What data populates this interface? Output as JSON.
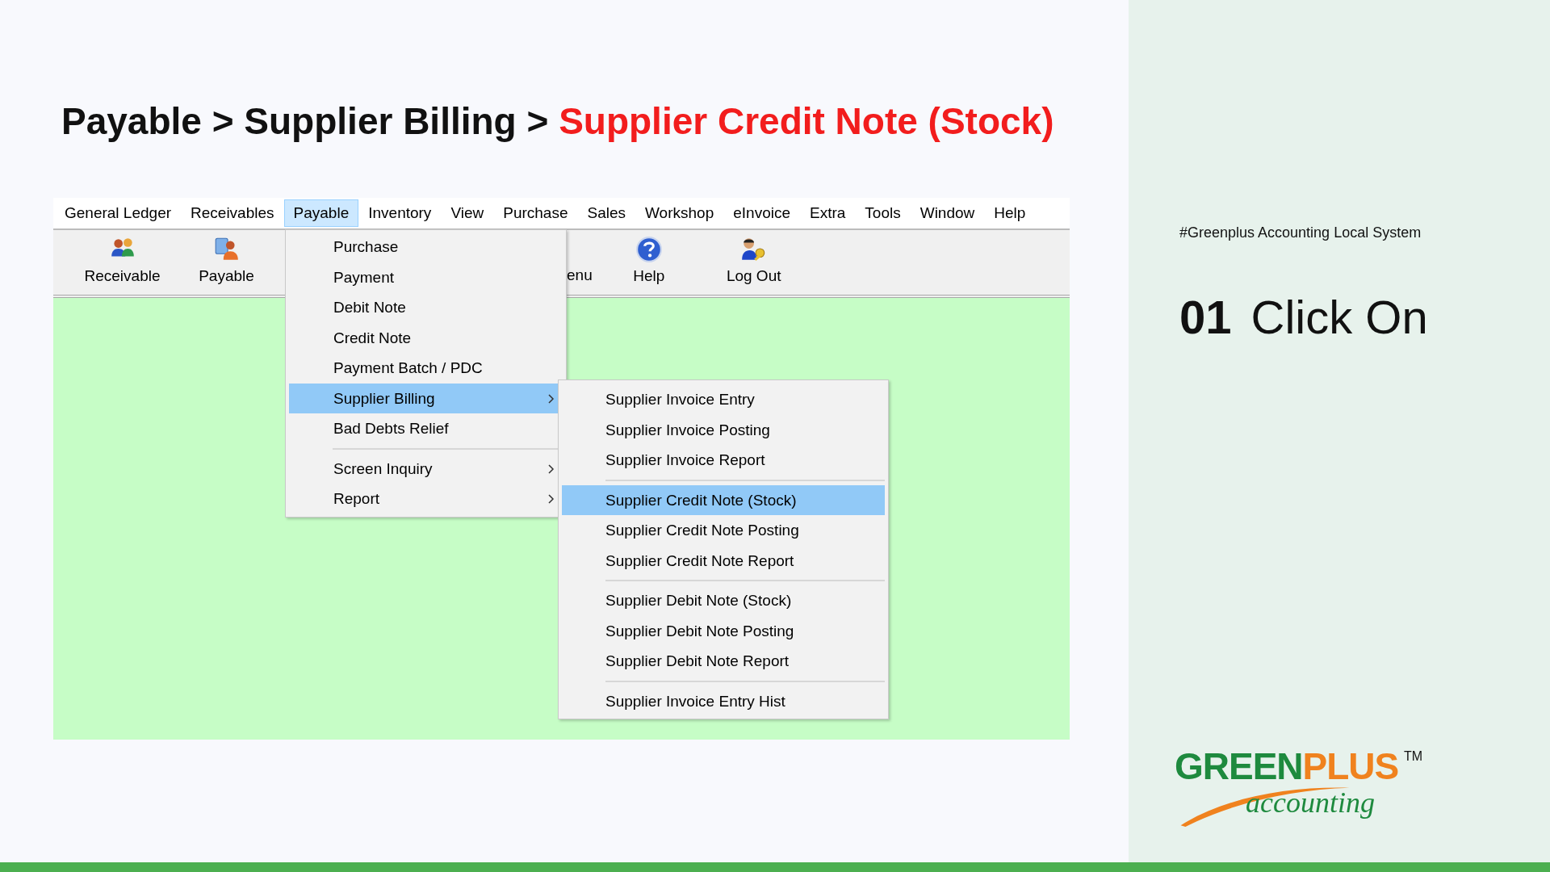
{
  "slide_title": {
    "parts": [
      {
        "text": "Payable",
        "kind": "crumb",
        "current": false
      },
      {
        "text": ">",
        "kind": "separator"
      },
      {
        "text": "Supplier Billing",
        "kind": "crumb",
        "current": false
      },
      {
        "text": ">",
        "kind": "separator"
      },
      {
        "text": "Supplier Credit Note (Stock)",
        "kind": "crumb",
        "current": true
      }
    ]
  },
  "app": {
    "menubar": [
      {
        "label": "General Ledger",
        "selected": false
      },
      {
        "label": "Receivables",
        "selected": false
      },
      {
        "label": "Payable",
        "selected": true
      },
      {
        "label": "Inventory",
        "selected": false
      },
      {
        "label": "View",
        "selected": false
      },
      {
        "label": "Purchase",
        "selected": false
      },
      {
        "label": "Sales",
        "selected": false
      },
      {
        "label": "Workshop",
        "selected": false
      },
      {
        "label": "eInvoice",
        "selected": false
      },
      {
        "label": "Extra",
        "selected": false
      },
      {
        "label": "Tools",
        "selected": false
      },
      {
        "label": "Window",
        "selected": false
      },
      {
        "label": "Help",
        "selected": false
      }
    ],
    "toolbar": [
      {
        "label": "Receivable",
        "kind": "receivable"
      },
      {
        "label": "Payable",
        "kind": "payable"
      },
      {
        "label": "enu",
        "kind": "partial"
      },
      {
        "label": "Help",
        "kind": "help"
      },
      {
        "label": "Log Out",
        "kind": "logout"
      }
    ],
    "dropdown": [
      {
        "kind": "item",
        "label": "Purchase",
        "selected": false,
        "submenu": false
      },
      {
        "kind": "item",
        "label": "Payment",
        "selected": false,
        "submenu": false
      },
      {
        "kind": "item",
        "label": "Debit Note",
        "selected": false,
        "submenu": false
      },
      {
        "kind": "item",
        "label": "Credit Note",
        "selected": false,
        "submenu": false
      },
      {
        "kind": "item",
        "label": "Payment Batch / PDC",
        "selected": false,
        "submenu": false
      },
      {
        "kind": "item",
        "label": "Supplier Billing",
        "selected": true,
        "submenu": true
      },
      {
        "kind": "item",
        "label": "Bad Debts Relief",
        "selected": false,
        "submenu": false
      },
      {
        "kind": "separator"
      },
      {
        "kind": "item",
        "label": "Screen Inquiry",
        "selected": false,
        "submenu": true
      },
      {
        "kind": "item",
        "label": "Report",
        "selected": false,
        "submenu": true
      }
    ],
    "submenu": [
      {
        "kind": "item",
        "label": "Supplier Invoice Entry",
        "selected": false,
        "submenu": false
      },
      {
        "kind": "item",
        "label": "Supplier Invoice Posting",
        "selected": false,
        "submenu": false
      },
      {
        "kind": "item",
        "label": "Supplier Invoice Report",
        "selected": false,
        "submenu": false
      },
      {
        "kind": "separator"
      },
      {
        "kind": "item",
        "label": "Supplier Credit Note (Stock)",
        "selected": true,
        "submenu": false
      },
      {
        "kind": "item",
        "label": "Supplier Credit Note Posting",
        "selected": false,
        "submenu": false
      },
      {
        "kind": "item",
        "label": "Supplier Credit Note Report",
        "selected": false,
        "submenu": false
      },
      {
        "kind": "separator"
      },
      {
        "kind": "item",
        "label": "Supplier Debit Note (Stock)",
        "selected": false,
        "submenu": false
      },
      {
        "kind": "item",
        "label": "Supplier Debit Note Posting",
        "selected": false,
        "submenu": false
      },
      {
        "kind": "item",
        "label": "Supplier Debit Note Report",
        "selected": false,
        "submenu": false
      },
      {
        "kind": "separator"
      },
      {
        "kind": "item",
        "label": "Supplier Invoice Entry Hist",
        "selected": false,
        "submenu": false
      }
    ]
  },
  "side_panel": {
    "hashtag": "#Greenplus Accounting Local System",
    "step_number": "01",
    "step_label": "Click On"
  },
  "logo": {
    "parts": [
      {
        "text": "GREEN",
        "color": "#1e8a3e"
      },
      {
        "text": "PLUS",
        "color": "#f0821e"
      }
    ],
    "mark": "TM",
    "tagline": "accounting"
  }
}
